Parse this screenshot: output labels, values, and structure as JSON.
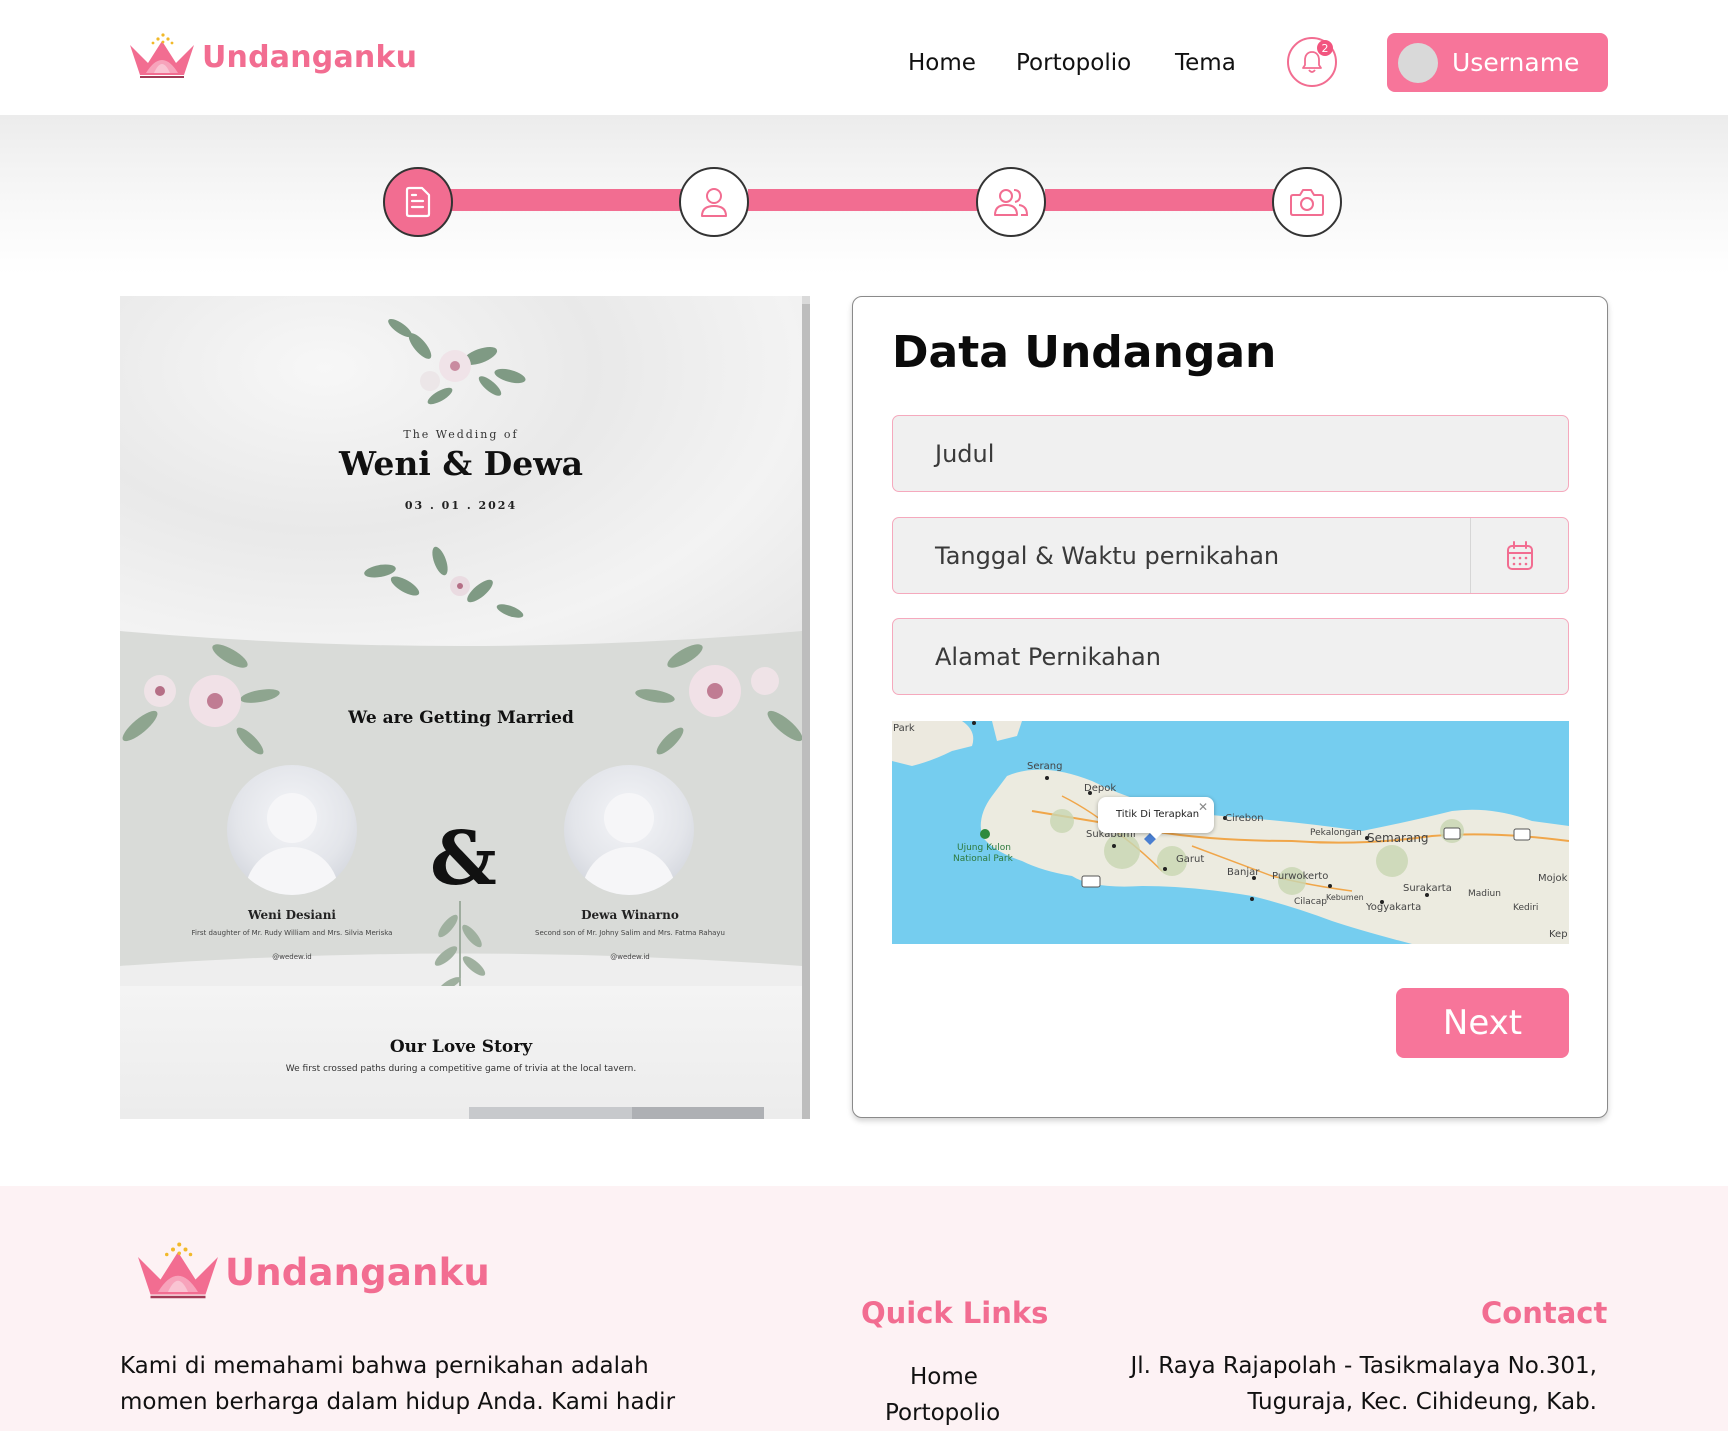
{
  "header": {
    "brand": "Undanganku",
    "nav": [
      "Home",
      "Portopolio",
      "Tema"
    ],
    "notification_count": "2",
    "username": "Username"
  },
  "colors": {
    "accent": "#f26d91",
    "button": "#f7759a",
    "footer_bg": "#fdf2f4",
    "map_water": "#75cdef"
  },
  "stepper": {
    "steps": [
      {
        "icon": "document-icon",
        "active": true
      },
      {
        "icon": "user-icon",
        "active": false
      },
      {
        "icon": "couple-icon",
        "active": false
      },
      {
        "icon": "camera-icon",
        "active": false
      }
    ]
  },
  "preview": {
    "subtitle": "The Wedding of",
    "couple": "Weni & Dewa",
    "date": "03 . 01 . 2024",
    "getting_married": "We are Getting Married",
    "ampersand": "&",
    "bride_name": "Weni Desiani",
    "bride_desc": "First daughter of Mr. Rudy William and Mrs. Silvia Meriska",
    "bride_ig": "@wedew.id",
    "groom_name": "Dewa Winarno",
    "groom_desc": "Second son of Mr. Johny Salim and Mrs. Fatma Rahayu",
    "groom_ig": "@wedew.id",
    "love_story_title": "Our Love Story",
    "love_story_text": "We first crossed paths during a competitive game of trivia at the local tavern."
  },
  "form": {
    "title": "Data Undangan",
    "judul_placeholder": "Judul",
    "tanggal_placeholder": "Tanggal & Waktu pernikahan",
    "alamat_placeholder": "Alamat Pernikahan",
    "map_popup": "Titik Di Terapkan",
    "map_labels": [
      "Park",
      "Serang",
      "Depok",
      "Cirebon",
      "Pekalongan",
      "Semarang",
      "Ujung Kulon",
      "National Park",
      "Sukabumi",
      "Garut",
      "Banjar",
      "Purwokerto",
      "Surakarta",
      "Madiun",
      "Mojok",
      "Cilacap",
      "Kebumen",
      "Yogyakarta",
      "Kediri",
      "Kep"
    ],
    "next_label": "Next"
  },
  "footer": {
    "brand": "Undanganku",
    "about": "Kami di  memahami bahwa pernikahan adalah momen berharga dalam hidup Anda. Kami hadir",
    "quick_links_title": "Quick Links",
    "quick_links": [
      "Home",
      "Portopolio"
    ],
    "contact_title": "Contact",
    "contact_address": "Jl. Raya Rajapolah - Tasikmalaya No.301, Tuguraja, Kec. Cihideung, Kab."
  }
}
